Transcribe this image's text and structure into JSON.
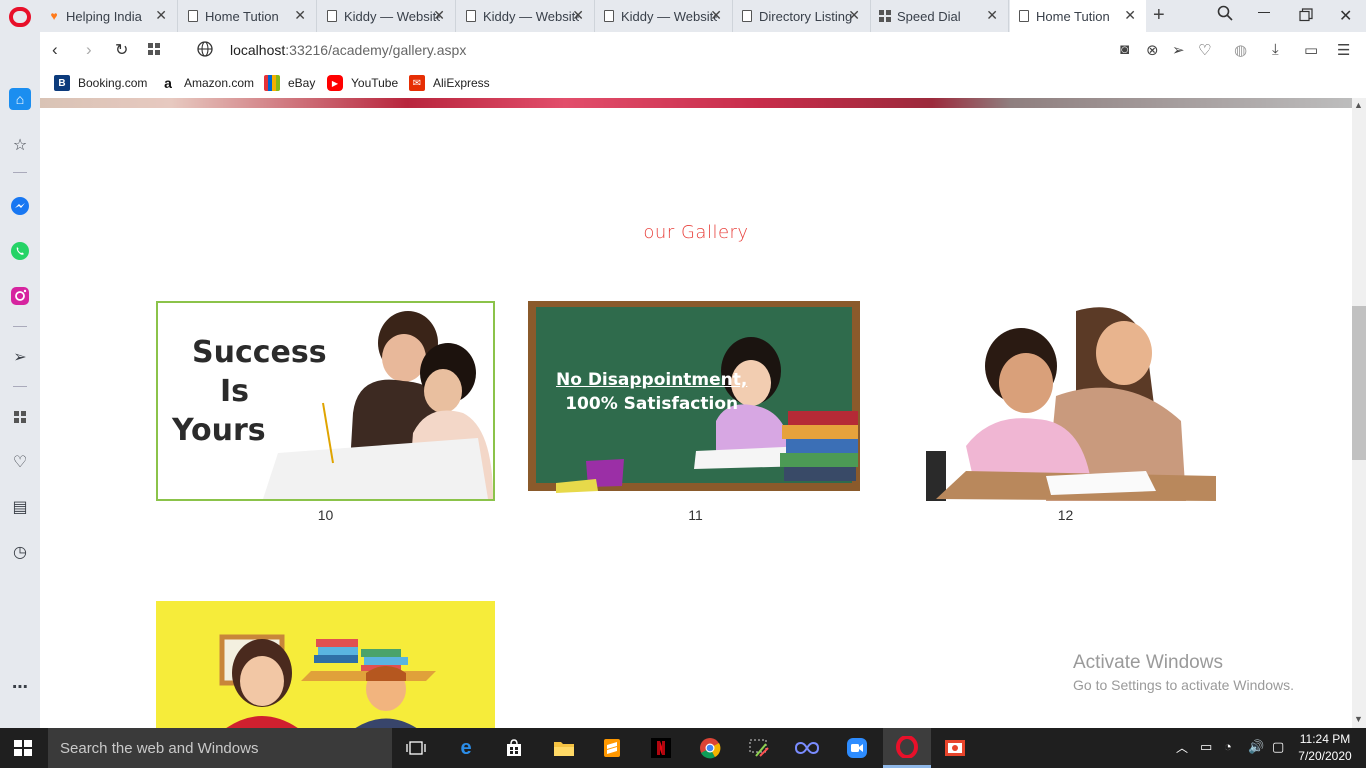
{
  "browser": {
    "tabs": [
      {
        "label": "Helping India",
        "icon": "heart-icon"
      },
      {
        "label": "Home Tution",
        "icon": "doc-icon"
      },
      {
        "label": "Kiddy — Website",
        "icon": "doc-icon"
      },
      {
        "label": "Kiddy — Website",
        "icon": "doc-icon"
      },
      {
        "label": "Kiddy — Website",
        "icon": "doc-icon"
      },
      {
        "label": "Directory Listing",
        "icon": "doc-icon"
      },
      {
        "label": "Speed Dial",
        "icon": "grid-icon"
      },
      {
        "label": "Home Tution",
        "icon": "doc-icon",
        "active": true
      }
    ],
    "address": {
      "host": "localhost",
      "path": ":33216/academy/gallery.aspx"
    },
    "bookmarks": [
      {
        "label": "Booking.com",
        "badge": "B",
        "color": "#0c3b7c"
      },
      {
        "label": "Amazon.com",
        "badge": "a",
        "color": "#ffffff"
      },
      {
        "label": "eBay",
        "badge": "",
        "color": "#e53238"
      },
      {
        "label": "YouTube",
        "badge": "▶",
        "color": "#ff0000"
      },
      {
        "label": "AliExpress",
        "badge": "✉",
        "color": "#e62e04"
      }
    ]
  },
  "page": {
    "gallery_title": "our Gallery",
    "items": [
      {
        "caption": "10",
        "image_text": [
          "Success",
          "Is",
          "Yours"
        ]
      },
      {
        "caption": "11",
        "image_text": [
          "No Disappointment,",
          "100% Satisfaction"
        ]
      },
      {
        "caption": "12"
      },
      {
        "caption": ""
      }
    ]
  },
  "watermark": {
    "line1": "Activate Windows",
    "line2": "Go to Settings to activate Windows."
  },
  "taskbar": {
    "search_placeholder": "Search the web and Windows",
    "time": "11:24 PM",
    "date": "7/20/2020"
  },
  "colors": {
    "accent": "#e8413c",
    "opera": "#e8102a",
    "taskbar": "#1f1f1f"
  }
}
